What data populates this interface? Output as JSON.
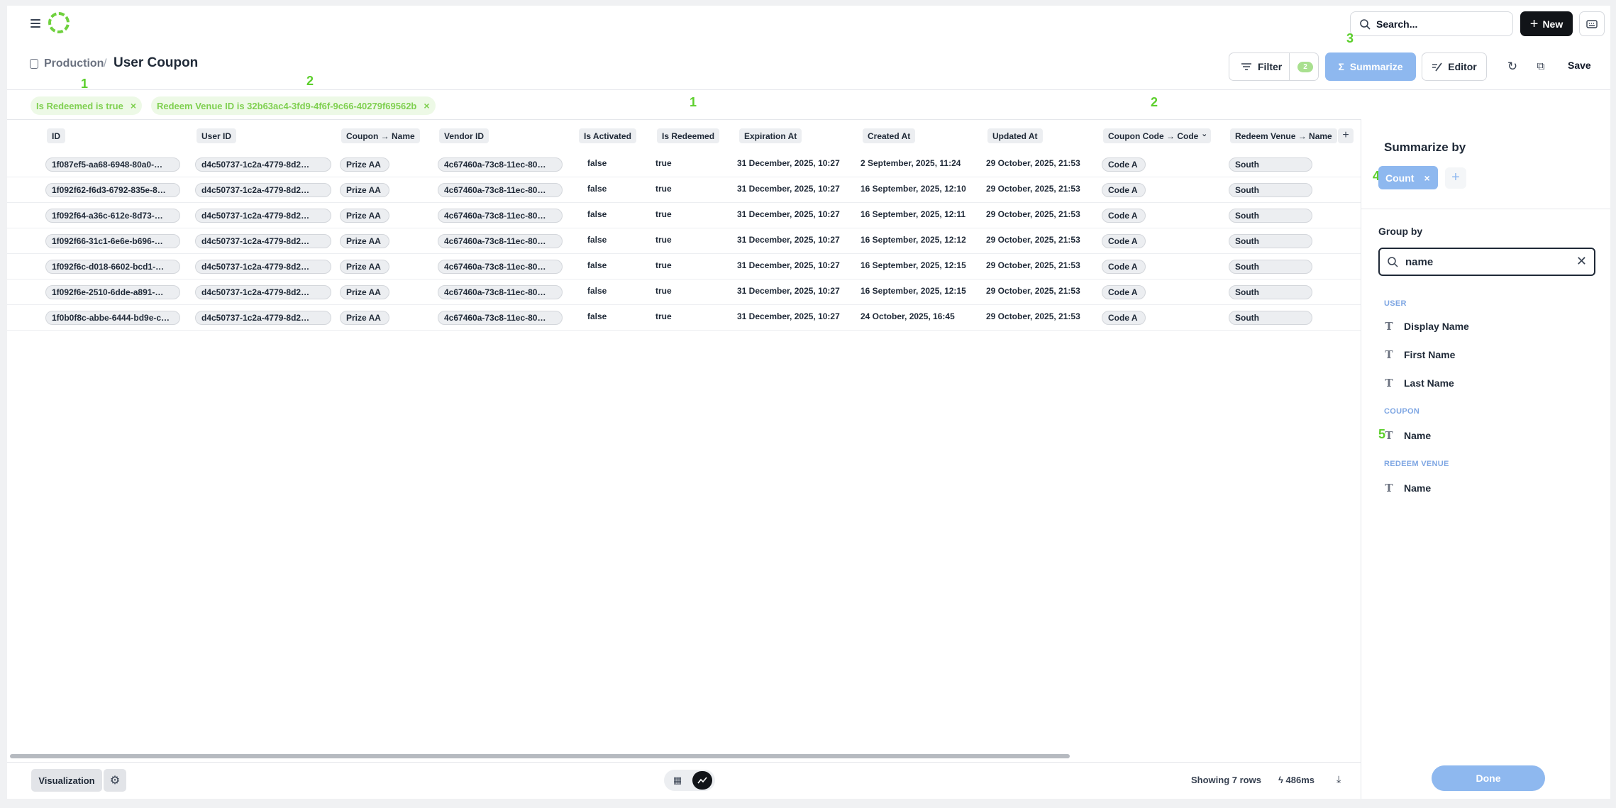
{
  "topbar": {
    "search_placeholder": "Search...",
    "new_label": "New"
  },
  "breadcrumb": {
    "parent": "Production",
    "separator": "/",
    "title": "User Coupon"
  },
  "toolbar": {
    "filter_label": "Filter",
    "filter_count": "2",
    "summarize_label": "Summarize",
    "editor_label": "Editor",
    "save_label": "Save"
  },
  "annotations": {
    "a1": "1",
    "a2": "2",
    "a3": "3",
    "a1b": "1",
    "a2b": "2",
    "a4": "4",
    "a5": "5"
  },
  "filters": [
    {
      "label": "Is Redeemed is true"
    },
    {
      "label": "Redeem Venue ID is 32b63ac4-3fd9-4f6f-9c66-40279f69562b"
    }
  ],
  "table": {
    "columns": [
      "ID",
      "User ID",
      "Coupon → Name",
      "Vendor ID",
      "Is Activated",
      "Is Redeemed",
      "Expiration At",
      "Created At",
      "Updated At",
      "Coupon Code → Code",
      "Redeem Venue → Name"
    ],
    "rows": [
      [
        "1f087ef5-aa68-6948-80a0-…",
        "d4c50737-1c2a-4779-8d2…",
        "Prize AA",
        "4c67460a-73c8-11ec-80…",
        "false",
        "true",
        "31 December, 2025, 10:27",
        "2 September, 2025, 11:24",
        "29 October, 2025, 21:53",
        "Code A",
        "South"
      ],
      [
        "1f092f62-f6d3-6792-835e-8…",
        "d4c50737-1c2a-4779-8d2…",
        "Prize AA",
        "4c67460a-73c8-11ec-80…",
        "false",
        "true",
        "31 December, 2025, 10:27",
        "16 September, 2025, 12:10",
        "29 October, 2025, 21:53",
        "Code A",
        "South"
      ],
      [
        "1f092f64-a36c-612e-8d73-…",
        "d4c50737-1c2a-4779-8d2…",
        "Prize AA",
        "4c67460a-73c8-11ec-80…",
        "false",
        "true",
        "31 December, 2025, 10:27",
        "16 September, 2025, 12:11",
        "29 October, 2025, 21:53",
        "Code A",
        "South"
      ],
      [
        "1f092f66-31c1-6e6e-b696-…",
        "d4c50737-1c2a-4779-8d2…",
        "Prize AA",
        "4c67460a-73c8-11ec-80…",
        "false",
        "true",
        "31 December, 2025, 10:27",
        "16 September, 2025, 12:12",
        "29 October, 2025, 21:53",
        "Code A",
        "South"
      ],
      [
        "1f092f6c-d018-6602-bcd1-…",
        "d4c50737-1c2a-4779-8d2…",
        "Prize AA",
        "4c67460a-73c8-11ec-80…",
        "false",
        "true",
        "31 December, 2025, 10:27",
        "16 September, 2025, 12:15",
        "29 October, 2025, 21:53",
        "Code A",
        "South"
      ],
      [
        "1f092f6e-2510-6dde-a891-…",
        "d4c50737-1c2a-4779-8d2…",
        "Prize AA",
        "4c67460a-73c8-11ec-80…",
        "false",
        "true",
        "31 December, 2025, 10:27",
        "16 September, 2025, 12:15",
        "29 October, 2025, 21:53",
        "Code A",
        "South"
      ],
      [
        "1f0b0f8c-abbe-6444-bd9e-c…",
        "d4c50737-1c2a-4779-8d2…",
        "Prize AA",
        "4c67460a-73c8-11ec-80…",
        "false",
        "true",
        "31 December, 2025, 10:27",
        "24 October, 2025, 16:45",
        "29 October, 2025, 21:53",
        "Code A",
        "South"
      ]
    ]
  },
  "sidebar": {
    "summarize_title": "Summarize by",
    "metric": "Count",
    "group_by_title": "Group by",
    "search_value": "name",
    "sections": [
      {
        "title": "USER",
        "fields": [
          "Display Name",
          "First Name",
          "Last Name"
        ]
      },
      {
        "title": "COUPON",
        "fields": [
          "Name"
        ]
      },
      {
        "title": "REDEEM VENUE",
        "fields": [
          "Name"
        ]
      }
    ],
    "done_label": "Done"
  },
  "footer": {
    "visualization_label": "Visualization",
    "rows_text": "Showing 7 rows",
    "timing_text": "486ms"
  },
  "colors": {
    "accent": "#8eb8ef",
    "annotation": "#5ccf2c",
    "filter_pill_bg": "#edf9e6",
    "dark_button": "#111418"
  }
}
